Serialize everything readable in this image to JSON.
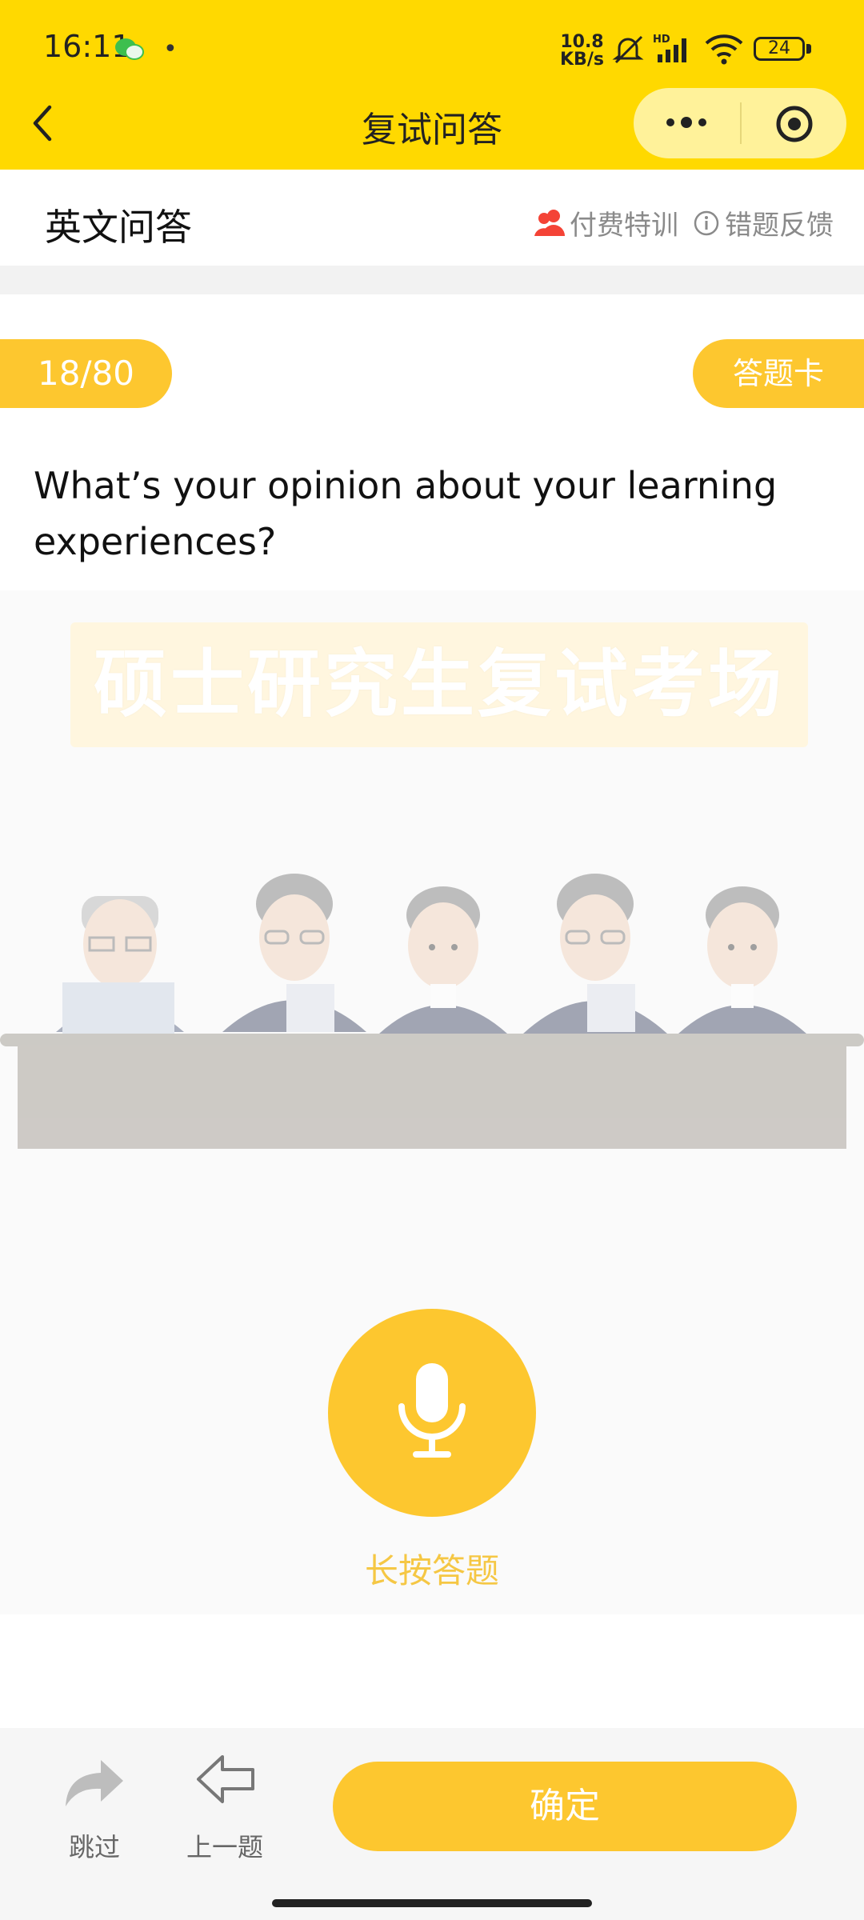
{
  "status_bar": {
    "time": "16:11",
    "dot": "•",
    "net_speed_value": "10.8",
    "net_speed_unit": "KB/s",
    "battery": "24",
    "icons": [
      "wechat-icon",
      "mute-icon",
      "signal-icon",
      "wifi-icon",
      "battery-icon"
    ]
  },
  "header": {
    "title": "复试问答",
    "back_icon": "chevron-left-icon",
    "menu_icon": "more-dots-icon",
    "close_icon": "target-icon"
  },
  "subheader": {
    "title": "英文问答",
    "paid_training": "付费特训",
    "feedback": "错题反馈"
  },
  "progress": {
    "text": "18/80",
    "answer_card": "答题卡"
  },
  "question": "What’s your opinion about your learning experiences?",
  "scene": {
    "banner": "硕士研究生复试考场"
  },
  "record": {
    "hold_label": "长按答题"
  },
  "bottom": {
    "skip": "跳过",
    "prev": "上一题",
    "confirm": "确定"
  },
  "colors": {
    "header_yellow": "#FFD900",
    "accent": "#FDC72F",
    "paid_icon": "#F44336"
  }
}
